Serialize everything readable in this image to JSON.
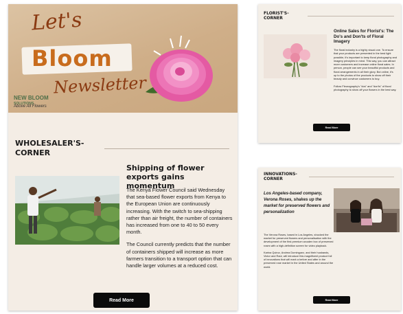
{
  "main": {
    "hero": {
      "lets": "Let's",
      "bloom": "Bloom",
      "newsletter": "Newsletter",
      "logo_line1": "NEW BLOOM",
      "logo_line2": "SOLUTIONS",
      "tagline": "Above All Flowers"
    },
    "section_title": "WHOLESALER'S-CORNER",
    "article": {
      "title": "Shipping of flower exports gains momentum",
      "paragraphs": [
        "The Kenya Flower Council said Wednesday that sea-based flower exports from Kenya to the European Union are continuously increasing. With the switch to sea-shipping rather than air freight, the number of containers has increased from one to 40 to 50 every month.",
        "The Council currently predicts that the number of containers shipped will increase as more farmers transition to a transport option that can handle larger volumes at a reduced cost."
      ],
      "read_more": "Read More"
    }
  },
  "florist": {
    "section_title": "FLORIST'S-CORNER",
    "heading": "Online Sales for Florist's: The Do's and Don'ts of Floral Imagery",
    "paragraphs": [
      "The floral industry is a highly visual one. To ensure that your products are presented in the best light possible, it's important to keep floral photography and imagery principles in mind. This way, you can attract more customers and increase online floral sales. In person, people can see your beautiful products and floral arrangements in all their glory. But online, it's up to the photos of the products to show off their beauty and convince customers to buy.",
      "Follow Fleurography's \"dos\" and \"don'ts\" of floral photography to show off your flowers in the best way."
    ],
    "read_more": "Read More"
  },
  "innovations": {
    "section_title": "INNOVATIONS-CORNER",
    "heading": "Los Angeles-based company, Verona Roses, shakes up the market for preserved flowers and personalization",
    "paragraphs": [
      "The Verona Roses, based in Los Angeles, shocked the market for preserved flowers and personalisation with the development of the first premium wooden box of preserved roses with a high-definition screen for video playback.",
      "Karina Quiroz, Andrea Dominguez, and their husbands, Victor and Raúl, will introduce this magnificent product full of innovations that will mark a before and after in the preserved rose market in the United States and around the world."
    ],
    "read_more": "Read More"
  },
  "colors": {
    "hero_bg": "#d4b592",
    "card_bg": "#f4ede5",
    "title_brown": "#8a3a12",
    "bloom_orange": "#c86c1d",
    "button_black": "#0b0b0b",
    "peony_pink": "#e45aa3"
  },
  "icons": {
    "hero_image": "pink-peony-flower",
    "article_image": "greenhouse-farmers-photo",
    "florist_image": "pink-rose-bouquet-photo",
    "innovations_image": "team-photo"
  }
}
